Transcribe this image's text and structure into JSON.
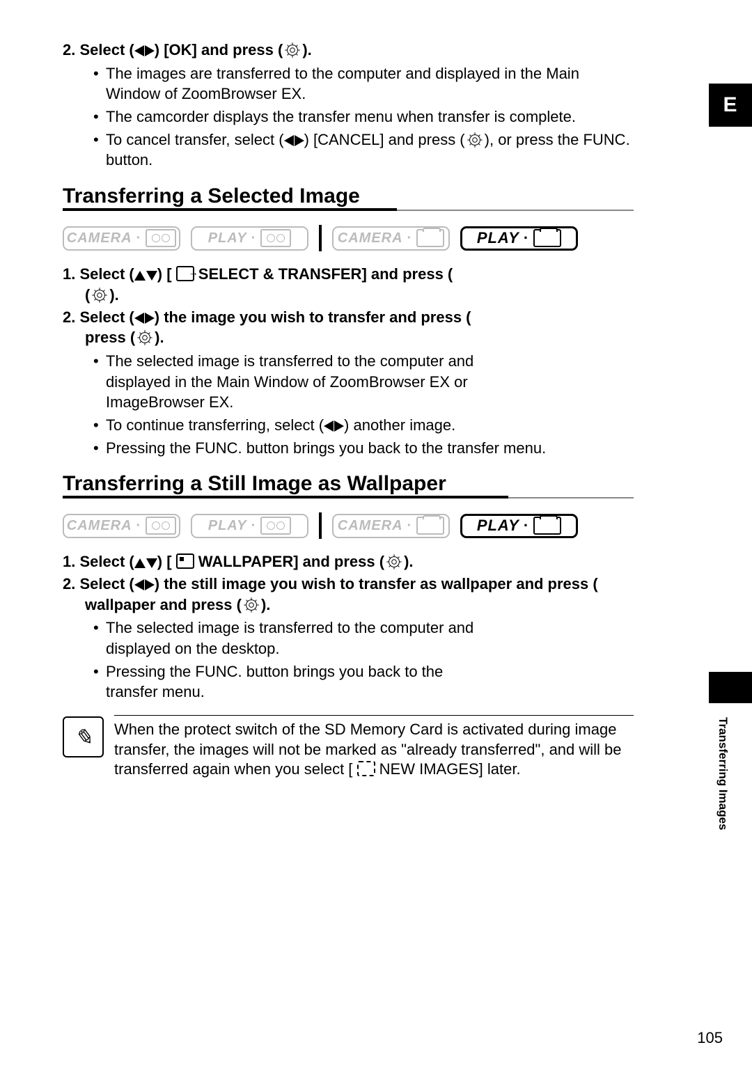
{
  "pageNumber": "105",
  "sideTabLetter": "E",
  "sideTabLabel": "Transferring Images",
  "step2": {
    "num": "2.",
    "prefix": "Select (",
    "label": ") [OK] and press (",
    "suffix": ")."
  },
  "step2Bullets": {
    "b0": "The images are transferred to the computer and displayed in the Main Window of ZoomBrowser EX.",
    "b1": "The camcorder displays the transfer menu when transfer is complete.",
    "b2a": "To cancel transfer, select (",
    "b2b": ") [CANCEL] and press (",
    "b2c": "), or press the FUNC. button."
  },
  "sectionA": {
    "heading": "Transferring a Selected Image",
    "s1": {
      "num": "1.",
      "p1": "Select (",
      "p2": ") [",
      "p3": "SELECT & TRANSFER] and press (",
      "p4": ")."
    },
    "s2": {
      "num": "2.",
      "p1": "Select (",
      "p2": ") the image you wish to transfer and press (",
      "p3": ")."
    },
    "bul": {
      "b0": "The selected image is transferred to the computer and displayed in the Main Window of ZoomBrowser EX or ImageBrowser EX.",
      "b1a": "To continue transferring, select (",
      "b1b": ") another image.",
      "b2": "Pressing the FUNC. button brings you back to the transfer menu."
    }
  },
  "sectionB": {
    "heading": "Transferring a Still Image as Wallpaper",
    "s1": {
      "num": "1.",
      "p1": "Select (",
      "p2": ") [",
      "p3": "WALLPAPER] and press (",
      "p4": ")."
    },
    "s2": {
      "num": "2.",
      "p1": "Select (",
      "p2": ") the still image you wish to transfer as wallpaper and press (",
      "p3": ")."
    },
    "bul": {
      "b0": "The selected image is transferred to the computer and displayed on the desktop.",
      "b1": "Pressing the FUNC. button brings you back to the transfer menu."
    }
  },
  "note": {
    "p1": "When the protect switch of the SD Memory Card is activated during image transfer, the images will not be marked as \"already transferred\", and will be transferred again when you select [",
    "p2": "NEW IMAGES] later."
  },
  "modeLabels": {
    "camera": "CAMERA",
    "play": "PLAY"
  }
}
